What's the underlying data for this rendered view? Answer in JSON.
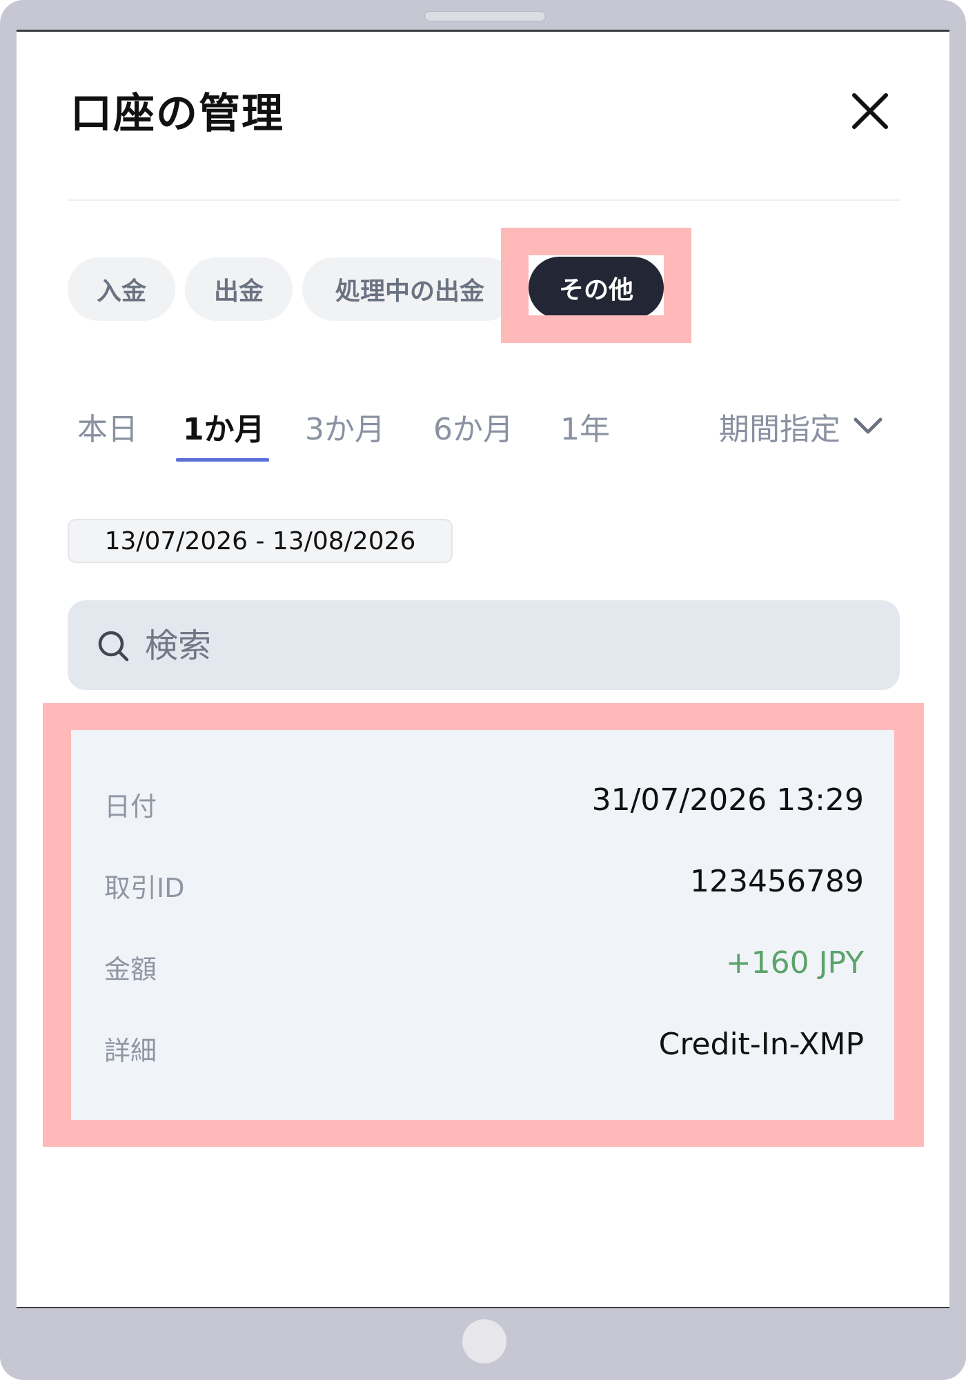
{
  "header": {
    "title": "口座の管理"
  },
  "tabs": [
    {
      "label": "入金",
      "active": false
    },
    {
      "label": "出金",
      "active": false
    },
    {
      "label": "処理中の出金",
      "active": false
    },
    {
      "label": "その他",
      "active": true
    }
  ],
  "periods": [
    {
      "label": "本日",
      "active": false
    },
    {
      "label": "1か月",
      "active": true
    },
    {
      "label": "3か月",
      "active": false
    },
    {
      "label": "6か月",
      "active": false
    },
    {
      "label": "1年",
      "active": false
    }
  ],
  "custom_period": {
    "label": "期間指定"
  },
  "date_range": "13/07/2026 - 13/08/2026",
  "search": {
    "placeholder": "検索",
    "value": ""
  },
  "transaction": {
    "date_label": "日付",
    "date_value": "31/07/2026 13:29",
    "id_label": "取引ID",
    "id_value": "123456789",
    "amount_label": "金額",
    "amount_value": "+160 JPY",
    "detail_label": "詳細",
    "detail_value": "Credit-In-XMP"
  },
  "colors": {
    "active_tab_bg": "#232634",
    "highlight": "#ffb9b9",
    "amount_positive": "#5aa36a",
    "period_underline": "#5b6fd8"
  },
  "icons": [
    "close-icon",
    "chevron-down-icon",
    "search-icon"
  ]
}
